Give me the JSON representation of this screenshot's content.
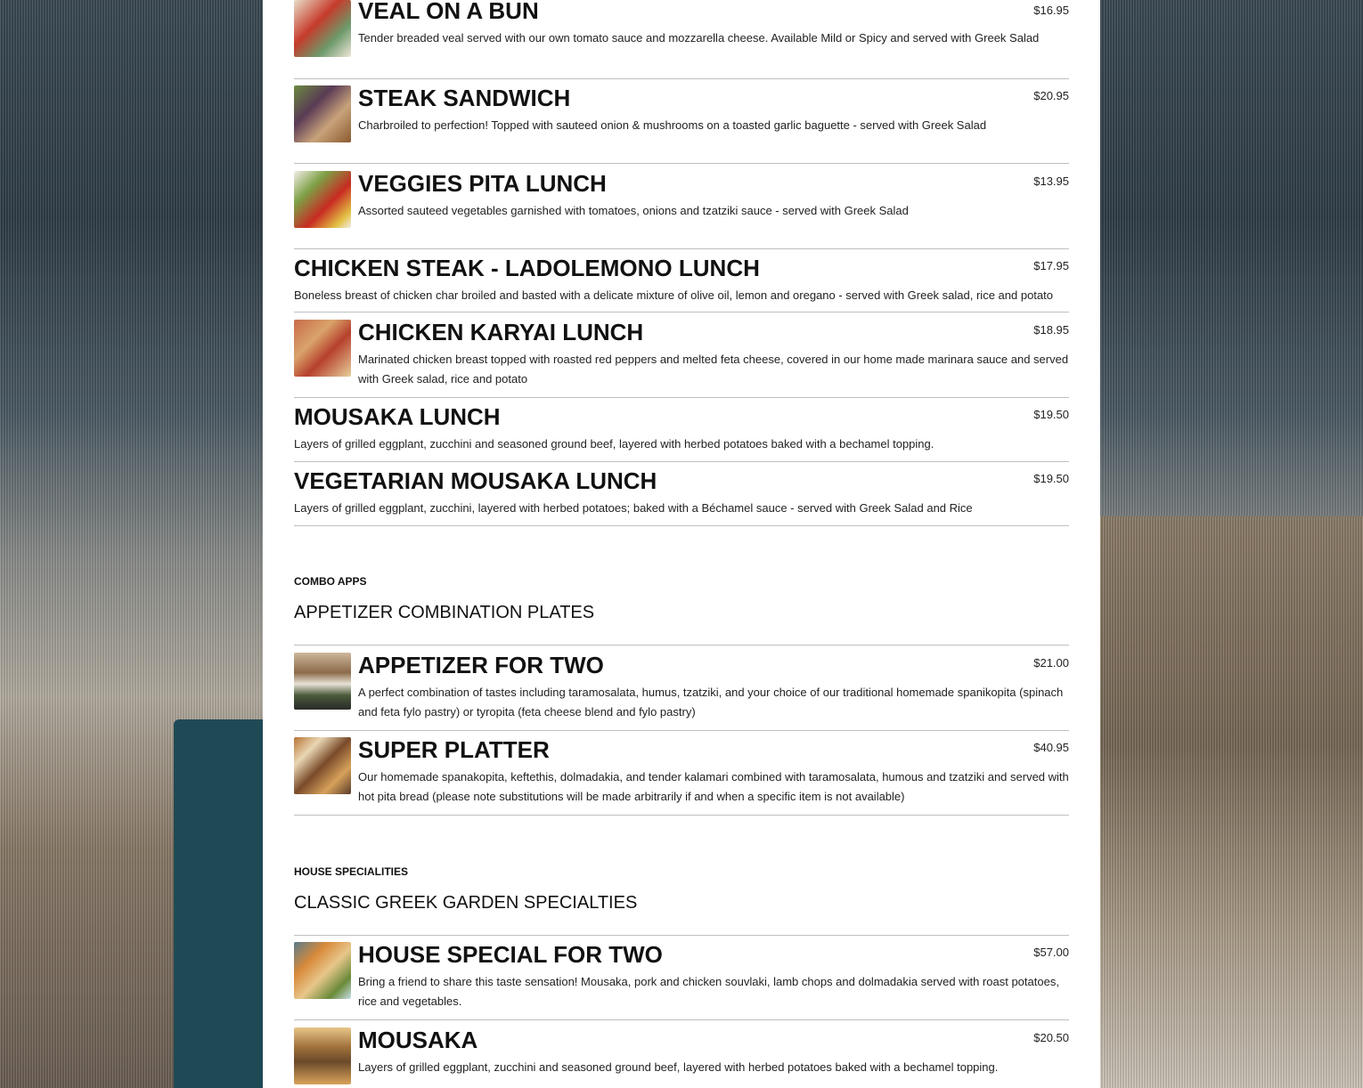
{
  "menu": {
    "lunch_items": [
      {
        "title": "VEAL ON A BUN",
        "price": "$16.95",
        "desc": "Tender breaded veal served with our own tomato sauce and mozzarella cheese. Available Mild or Spicy and served with Greek Salad"
      },
      {
        "title": "STEAK SANDWICH",
        "price": "$20.95",
        "desc": "Charbroiled to perfection! Topped with sauteed onion & mushrooms on a toasted garlic baguette - served with Greek Salad"
      },
      {
        "title": "VEGGIES PITA LUNCH",
        "price": "$13.95",
        "desc": "Assorted sauteed vegetables garnished with tomatoes, onions and tzatziki sauce - served with Greek Salad"
      },
      {
        "title": "CHICKEN STEAK - LADOLEMONO LUNCH",
        "price": "$17.95",
        "desc": "Boneless breast of chicken char broiled and basted with a delicate mixture of olive oil, lemon and oregano - served with Greek salad, rice and potato"
      },
      {
        "title": "CHICKEN KARYAI LUNCH",
        "price": "$18.95",
        "desc": "Marinated chicken breast topped with roasted red peppers and melted feta cheese, covered in our home made marinara sauce and served with Greek salad, rice and potato"
      },
      {
        "title": "MOUSAKA LUNCH",
        "price": "$19.50",
        "desc": "Layers of grilled eggplant, zucchini and seasoned ground beef, layered with herbed potatoes baked with a bechamel topping."
      },
      {
        "title": "VEGETARIAN MOUSAKA LUNCH",
        "price": "$19.50",
        "desc": "Layers of grilled eggplant, zucchini, layered with herbed potatoes; baked with a Béchamel sauce - served with Greek Salad and Rice"
      }
    ],
    "combo": {
      "label": "COMBO APPS",
      "title": "APPETIZER COMBINATION PLATES",
      "items": [
        {
          "title": "APPETIZER FOR TWO",
          "price": "$21.00",
          "desc": "A perfect combination of tastes including taramosalata, humus, tzatziki, and your choice of our traditional homemade spanikopita (spinach and feta fylo pastry) or tyropita (feta cheese blend and fylo pastry)"
        },
        {
          "title": "SUPER PLATTER",
          "price": "$40.95",
          "desc": "Our homemade spanakopita, keftethis, dolmadakia, and tender kalamari combined with taramosalata, humous and tzatziki and served with hot pita bread (please note substitutions will be made arbitrarily if and when a specific item is not available)"
        }
      ]
    },
    "house": {
      "label": "HOUSE SPECIALITIES",
      "title": "CLASSIC GREEK GARDEN SPECIALTIES",
      "items": [
        {
          "title": "HOUSE SPECIAL FOR TWO",
          "price": "$57.00",
          "desc": "Bring a friend to share this taste sensation! Mousaka, pork and chicken souvlaki, lamb chops and dolmadakia served with roast potatoes, rice and vegetables."
        },
        {
          "title": "MOUSAKA",
          "price": "$20.50",
          "desc": "Layers of grilled eggplant, zucchini and seasoned ground beef, layered with herbed potatoes baked with a bechamel topping."
        }
      ]
    }
  }
}
